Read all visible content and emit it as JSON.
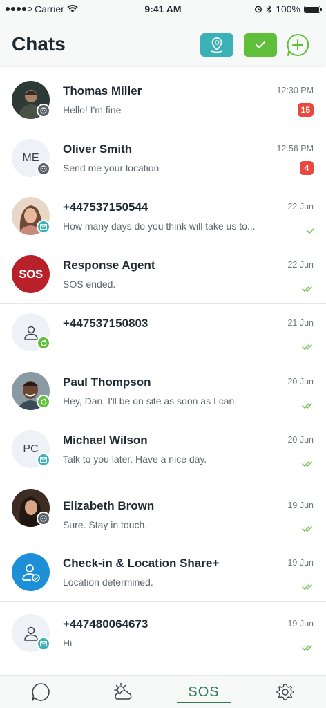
{
  "status_bar": {
    "carrier": "Carrier",
    "time": "9:41 AM",
    "battery": "100%"
  },
  "header": {
    "title": "Chats",
    "buttons": [
      "location-pin-icon",
      "checkmark-icon",
      "add-chat-icon"
    ]
  },
  "colors": {
    "teal": "#3bb0b7",
    "green": "#5fbf3a",
    "red_badge": "#e8493e",
    "sos_red": "#b8212a",
    "checkin_blue": "#1c8fd6",
    "tab_active": "#2f7a5a"
  },
  "chats": [
    {
      "name": "Thomas Miller",
      "message": "Hello! I'm fine",
      "time": "12:30 PM",
      "unread": "15",
      "avatar": "photo",
      "badge": "chat-icon"
    },
    {
      "name": "Oliver Smith",
      "message": "Send me your location",
      "time": "12:56 PM",
      "unread": "4",
      "avatar": "ME",
      "badge": "chat-icon"
    },
    {
      "name": "+447537150544",
      "message": "How many days do you think will take us to...",
      "time": "22 Jun",
      "status": "sent",
      "avatar": "photo",
      "badge": "mail-icon"
    },
    {
      "name": "Response Agent",
      "message": "SOS ended.",
      "time": "22 Jun",
      "status": "read",
      "avatar": "SOS",
      "badge": ""
    },
    {
      "name": "+447537150803",
      "message": "",
      "time": "21 Jun",
      "status": "read",
      "avatar": "person-icon",
      "badge": "sync-icon"
    },
    {
      "name": "Paul Thompson",
      "message": "Hey, Dan, I'll be on site as soon as I can.",
      "time": "20 Jun",
      "status": "read",
      "avatar": "photo",
      "badge": "sync-icon"
    },
    {
      "name": "Michael Wilson",
      "message": "Talk to you later. Have a nice day.",
      "time": "20 Jun",
      "status": "read",
      "avatar": "PC",
      "badge": "mail-icon"
    },
    {
      "name": "Elizabeth Brown",
      "message": "Sure. Stay in touch.",
      "time": "19 Jun",
      "status": "read",
      "avatar": "photo",
      "badge": "chat-icon"
    },
    {
      "name": "Check-in & Location Share+",
      "message": "Location determined.",
      "time": "19 Jun",
      "status": "read",
      "avatar": "checkin-icon",
      "badge": ""
    },
    {
      "name": "+447480064673",
      "message": "Hi",
      "time": "19 Jun",
      "status": "read",
      "avatar": "person-icon",
      "badge": "mail-icon"
    }
  ],
  "tabbar": {
    "tabs": [
      "chat-icon",
      "weather-icon",
      "SOS",
      "settings-icon"
    ],
    "active": "SOS",
    "sos_label": "SOS"
  }
}
